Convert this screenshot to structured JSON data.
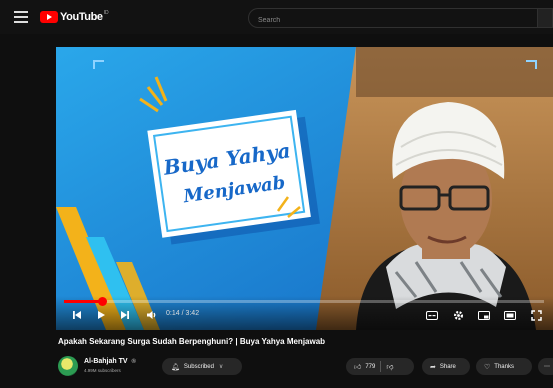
{
  "header": {
    "logo_text": "YouTube",
    "logo_sup": "ID",
    "search_placeholder": "Search"
  },
  "player": {
    "progress": 0.08,
    "time": "0:14 / 3:42",
    "thumbnail": {
      "card_line1": "Buya Yahya",
      "card_line2": "Menjawab"
    }
  },
  "video": {
    "title": "Apakah Sekarang Surga Sudah Berpenghuni? | Buya Yahya Menjawab"
  },
  "channel": {
    "name": "Al-Bahjah TV",
    "verified_mark": "®",
    "subscribers": "4.99M subscribers"
  },
  "actions": {
    "subscribed_label": "Subscribed",
    "like_count": "779",
    "share_label": "Share",
    "thanks_label": "Thanks"
  },
  "colors": {
    "accent": "#ff0000",
    "background": "#0f0f0f",
    "thumbnail_blue": "#1c8ad6"
  }
}
